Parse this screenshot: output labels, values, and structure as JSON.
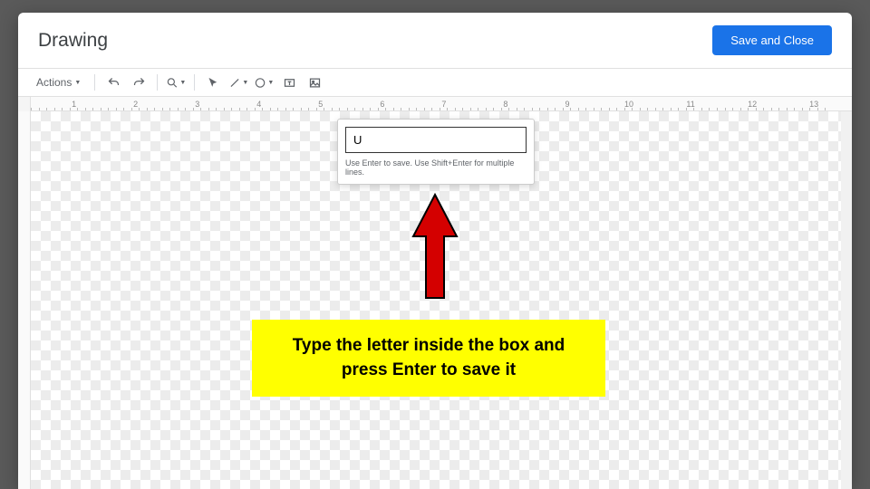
{
  "dialog": {
    "title": "Drawing",
    "save_button": "Save and Close"
  },
  "toolbar": {
    "actions_label": "Actions"
  },
  "ruler": {
    "ticks": [
      1,
      2,
      3,
      4,
      5,
      6,
      7,
      8,
      9,
      10,
      11,
      12,
      13
    ]
  },
  "text_edit": {
    "value": "U",
    "hint": "Use Enter to save. Use Shift+Enter for multiple lines."
  },
  "annotation": {
    "callout": "Type the letter inside the box and press Enter to save it"
  }
}
